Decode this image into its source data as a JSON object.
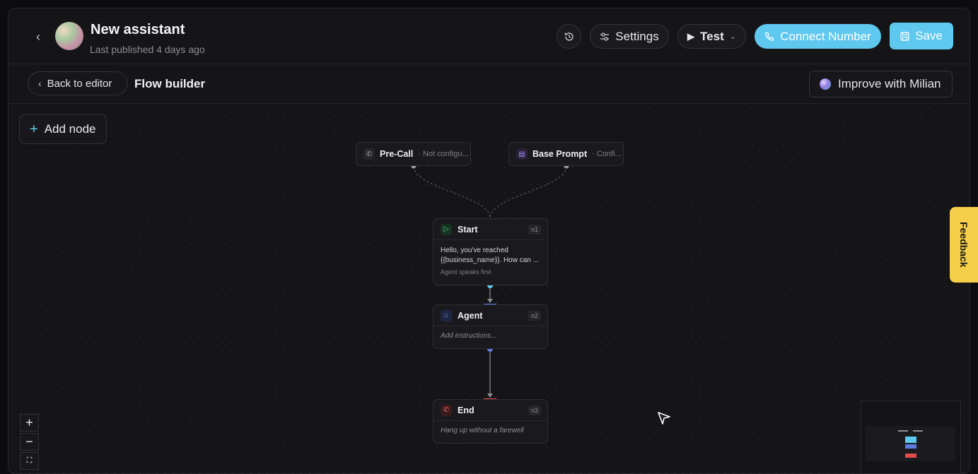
{
  "header": {
    "title": "New assistant",
    "subtitle": "Last published 4 days ago",
    "settings_label": "Settings",
    "test_label": "Test",
    "connect_label": "Connect Number",
    "save_label": "Save"
  },
  "subbar": {
    "back_label": "Back to editor",
    "flow_title": "Flow builder",
    "improve_label": "Improve with Milian"
  },
  "canvas": {
    "add_node_label": "Add node",
    "pills": [
      {
        "label": "Pre-Call",
        "meta": "· Not configu..."
      },
      {
        "label": "Base Prompt",
        "meta": "· Confi..."
      }
    ],
    "nodes": [
      {
        "label": "Start",
        "id": "n1",
        "text": "Hello, you've reached {{business_name}}. How can ...",
        "sub": "Agent speaks first"
      },
      {
        "label": "Agent",
        "id": "n2",
        "text": "Add instructions..."
      },
      {
        "label": "End",
        "id": "n3",
        "text": "Hang up without a farewell"
      }
    ],
    "zoom_in": "+",
    "zoom_out": "−"
  },
  "feedback_label": "Feedback",
  "colors": {
    "accent": "#5fc8ee",
    "start": "#4ade80",
    "agent": "#5b7de0",
    "end": "#e04b4b",
    "feedback": "#f5cf4a"
  }
}
